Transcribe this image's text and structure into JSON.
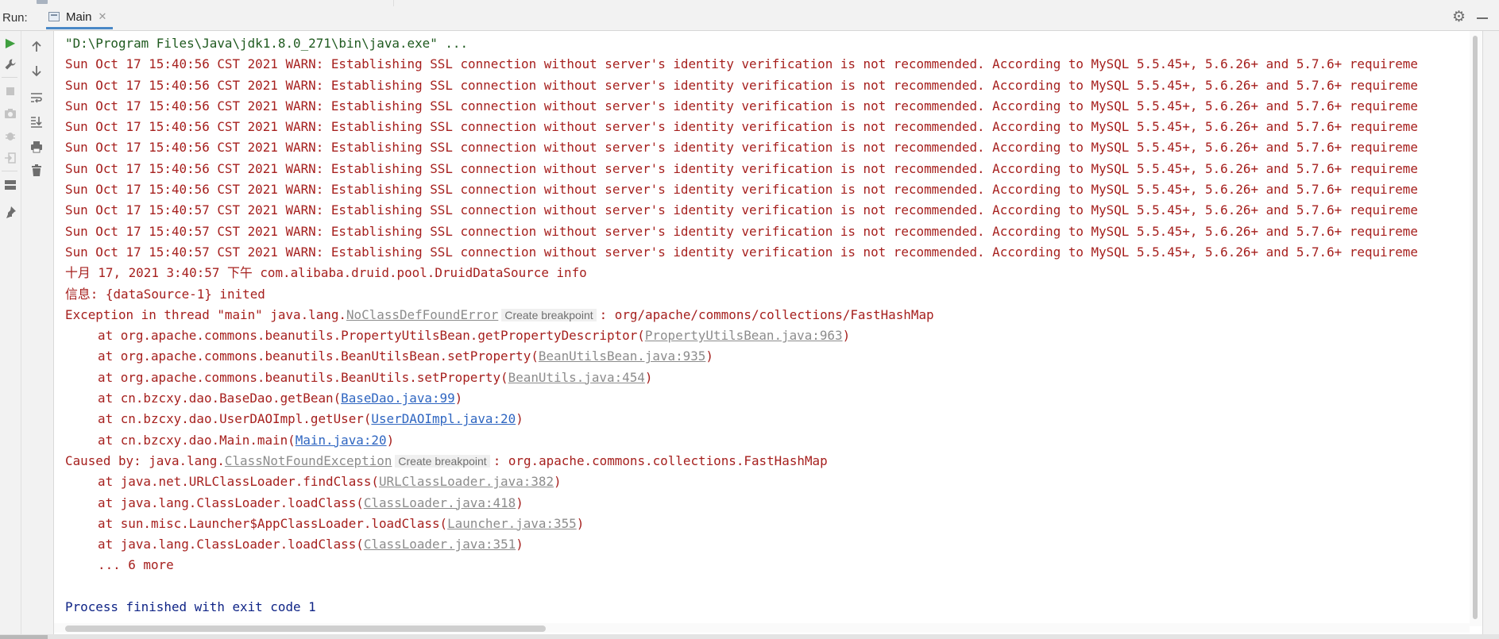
{
  "window": {
    "run_label": "Run:",
    "tab_label": "Main"
  },
  "icons": {
    "header": [
      "gear-icon",
      "minimize-icon",
      "close-icon"
    ],
    "toolbar": [
      "run-icon",
      "wrench-icon",
      "stop-icon",
      "camera-icon",
      "bug-icon",
      "exit-icon",
      "layout-icon",
      "pin-icon",
      "up-arrow-icon",
      "down-arrow-icon",
      "soft-wrap-icon",
      "scroll-to-end-icon",
      "print-icon",
      "trash-icon"
    ]
  },
  "colors": {
    "error_text": "#a6201e",
    "command_text": "#1f5a1f",
    "exit_text": "#0f2486",
    "link_blue": "#2f66c1",
    "link_gray": "#8c8c8c",
    "tab_underline": "#4a88c7"
  },
  "console": {
    "command": "\"D:\\Program Files\\Java\\jdk1.8.0_271\\bin\\java.exe\" ...",
    "warnings": [
      "Sun Oct 17 15:40:56 CST 2021 WARN: Establishing SSL connection without server's identity verification is not recommended. According to MySQL 5.5.45+, 5.6.26+ and 5.7.6+ requireme",
      "Sun Oct 17 15:40:56 CST 2021 WARN: Establishing SSL connection without server's identity verification is not recommended. According to MySQL 5.5.45+, 5.6.26+ and 5.7.6+ requireme",
      "Sun Oct 17 15:40:56 CST 2021 WARN: Establishing SSL connection without server's identity verification is not recommended. According to MySQL 5.5.45+, 5.6.26+ and 5.7.6+ requireme",
      "Sun Oct 17 15:40:56 CST 2021 WARN: Establishing SSL connection without server's identity verification is not recommended. According to MySQL 5.5.45+, 5.6.26+ and 5.7.6+ requireme",
      "Sun Oct 17 15:40:56 CST 2021 WARN: Establishing SSL connection without server's identity verification is not recommended. According to MySQL 5.5.45+, 5.6.26+ and 5.7.6+ requireme",
      "Sun Oct 17 15:40:56 CST 2021 WARN: Establishing SSL connection without server's identity verification is not recommended. According to MySQL 5.5.45+, 5.6.26+ and 5.7.6+ requireme",
      "Sun Oct 17 15:40:56 CST 2021 WARN: Establishing SSL connection without server's identity verification is not recommended. According to MySQL 5.5.45+, 5.6.26+ and 5.7.6+ requireme",
      "Sun Oct 17 15:40:57 CST 2021 WARN: Establishing SSL connection without server's identity verification is not recommended. According to MySQL 5.5.45+, 5.6.26+ and 5.7.6+ requireme",
      "Sun Oct 17 15:40:57 CST 2021 WARN: Establishing SSL connection without server's identity verification is not recommended. According to MySQL 5.5.45+, 5.6.26+ and 5.7.6+ requireme",
      "Sun Oct 17 15:40:57 CST 2021 WARN: Establishing SSL connection without server's identity verification is not recommended. According to MySQL 5.5.45+, 5.6.26+ and 5.7.6+ requireme"
    ],
    "log_info": "十月 17, 2021 3:40:57 下午 com.alibaba.druid.pool.DruidDataSource info",
    "log_inited": "信息: {dataSource-1} inited",
    "exception": {
      "prefix": "Exception in thread \"main\" java.lang.",
      "class_link": "NoClassDefFoundError",
      "hint": "Create breakpoint",
      "suffix": ": org/apache/commons/collections/FastHashMap"
    },
    "stack": [
      {
        "pre": "at org.apache.commons.beanutils.PropertyUtilsBean.getPropertyDescriptor(",
        "link": "PropertyUtilsBean.java:963",
        "style": "gray",
        "post": ")"
      },
      {
        "pre": "at org.apache.commons.beanutils.BeanUtilsBean.setProperty(",
        "link": "BeanUtilsBean.java:935",
        "style": "gray",
        "post": ")"
      },
      {
        "pre": "at org.apache.commons.beanutils.BeanUtils.setProperty(",
        "link": "BeanUtils.java:454",
        "style": "gray",
        "post": ")"
      },
      {
        "pre": "at cn.bzcxy.dao.BaseDao.getBean(",
        "link": "BaseDao.java:99",
        "style": "blue",
        "post": ")"
      },
      {
        "pre": "at cn.bzcxy.dao.UserDAOImpl.getUser(",
        "link": "UserDAOImpl.java:20",
        "style": "blue",
        "post": ")"
      },
      {
        "pre": "at cn.bzcxy.dao.Main.main(",
        "link": "Main.java:20",
        "style": "blue",
        "post": ")"
      }
    ],
    "caused_by": {
      "prefix": "Caused by: java.lang.",
      "class_link": "ClassNotFoundException",
      "hint": "Create breakpoint",
      "suffix": ": org.apache.commons.collections.FastHashMap"
    },
    "cause_stack": [
      {
        "pre": "at java.net.URLClassLoader.findClass(",
        "link": "URLClassLoader.java:382",
        "style": "gray",
        "post": ")"
      },
      {
        "pre": "at java.lang.ClassLoader.loadClass(",
        "link": "ClassLoader.java:418",
        "style": "gray",
        "post": ")"
      },
      {
        "pre": "at sun.misc.Launcher$AppClassLoader.loadClass(",
        "link": "Launcher.java:355",
        "style": "gray",
        "post": ")"
      },
      {
        "pre": "at java.lang.ClassLoader.loadClass(",
        "link": "ClassLoader.java:351",
        "style": "gray",
        "post": ")"
      }
    ],
    "more": "... 6 more",
    "exit": "Process finished with exit code 1"
  }
}
